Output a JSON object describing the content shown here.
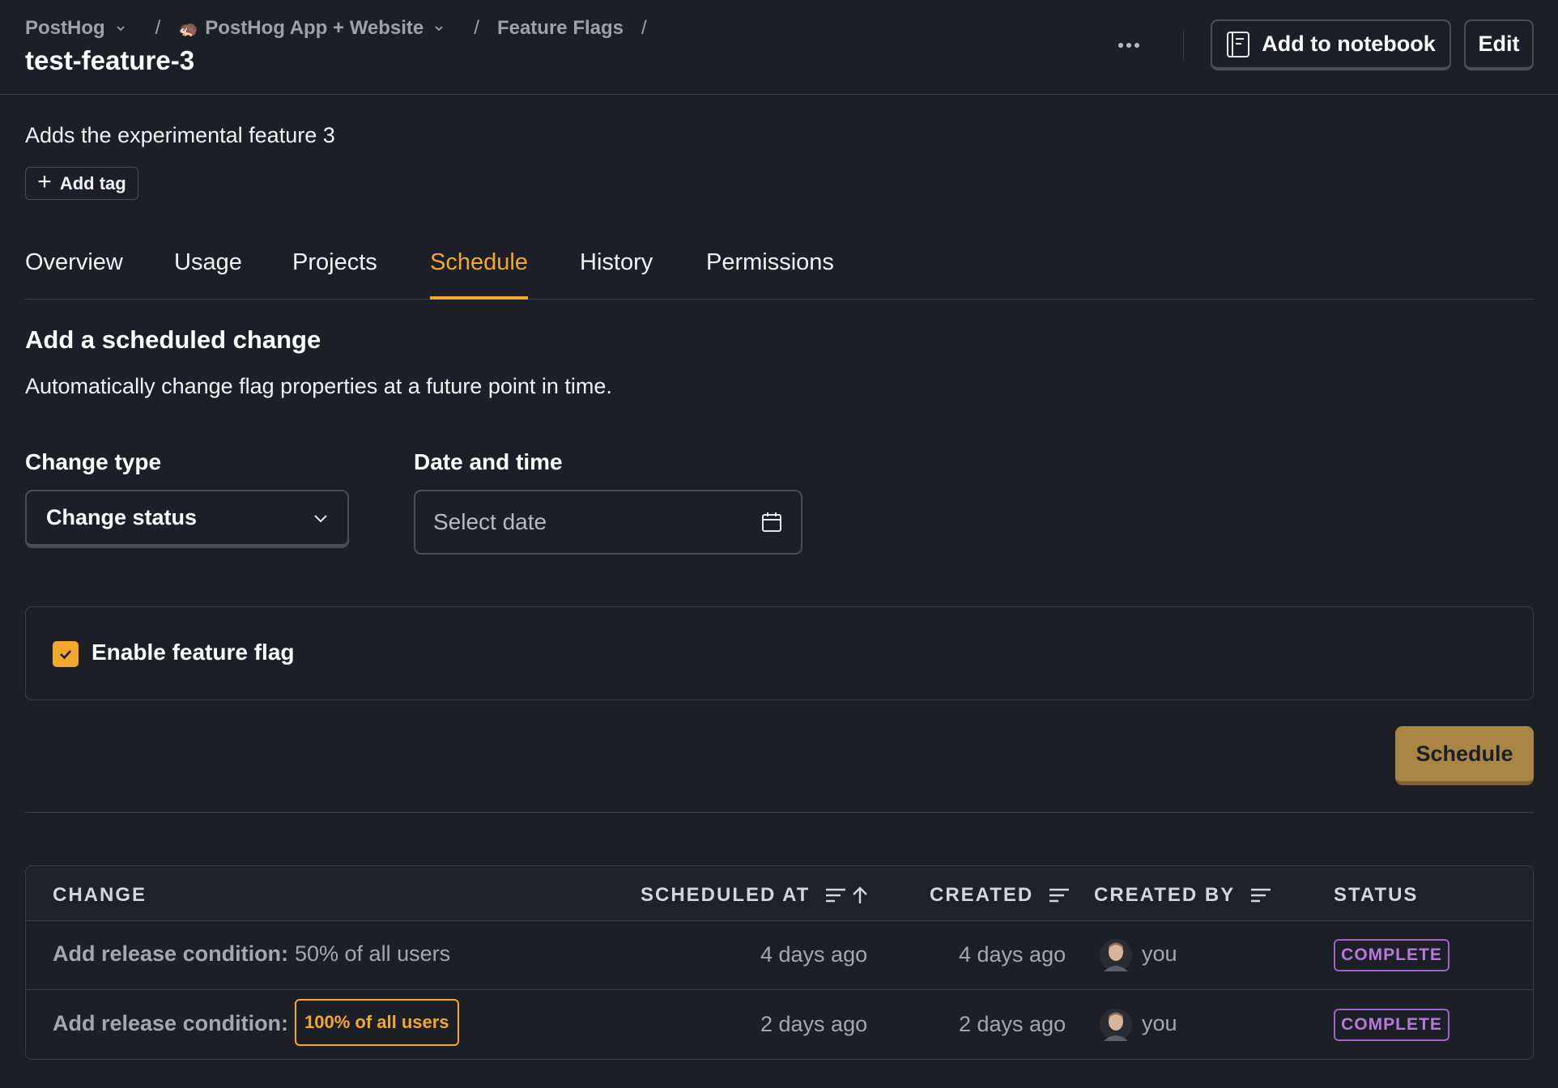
{
  "breadcrumb": {
    "org": "PostHog",
    "project": "PostHog App + Website",
    "section": "Feature Flags",
    "separator": "/"
  },
  "header": {
    "title": "test-feature-3",
    "add_to_notebook_label": "Add to notebook",
    "edit_label": "Edit"
  },
  "flag": {
    "description": "Adds the experimental feature 3",
    "add_tag_label": "Add tag"
  },
  "tabs": [
    {
      "label": "Overview",
      "active": false
    },
    {
      "label": "Usage",
      "active": false
    },
    {
      "label": "Projects",
      "active": false
    },
    {
      "label": "Schedule",
      "active": true
    },
    {
      "label": "History",
      "active": false
    },
    {
      "label": "Permissions",
      "active": false
    }
  ],
  "schedule_form": {
    "title": "Add a scheduled change",
    "subtitle": "Automatically change flag properties at a future point in time.",
    "change_type_label": "Change type",
    "change_type_value": "Change status",
    "date_label": "Date and time",
    "date_placeholder": "Select date",
    "enable_label": "Enable feature flag",
    "enable_checked": true,
    "schedule_button": "Schedule"
  },
  "table": {
    "columns": [
      "CHANGE",
      "SCHEDULED AT",
      "CREATED",
      "CREATED BY",
      "STATUS"
    ],
    "rows": [
      {
        "change_label": "Add release condition:",
        "change_value": "50% of all users",
        "scheduled_at": "4 days ago",
        "created": "4 days ago",
        "created_by": "you",
        "status": "COMPLETE"
      },
      {
        "change_label": "Add release condition:",
        "change_value": "100% of all users",
        "scheduled_at": "2 days ago",
        "created": "2 days ago",
        "created_by": "you",
        "status": "COMPLETE"
      }
    ]
  },
  "colors": {
    "background": "#1d1f27",
    "accent": "#f1a82c",
    "schedule_button": "#a98546",
    "status_purple": "#b57ad8",
    "border": "#3a3d47"
  },
  "icons": [
    "chevron-down-icon",
    "hedgehog-icon",
    "more-icon",
    "notebook-icon",
    "plus-icon",
    "calendar-icon",
    "check-icon",
    "sort-icon",
    "sort-ascending-icon",
    "avatar"
  ]
}
